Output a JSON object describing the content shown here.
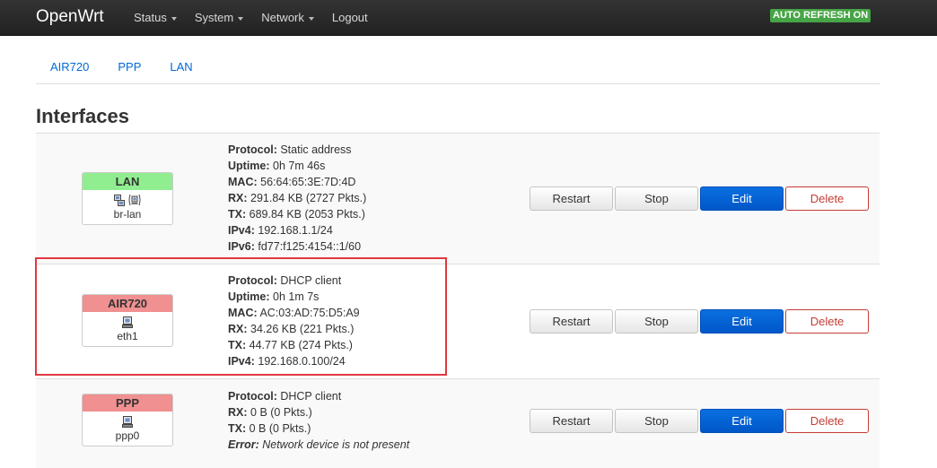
{
  "navbar": {
    "brand": "OpenWrt",
    "menu": [
      "Status",
      "System",
      "Network",
      "Logout"
    ],
    "autorefresh": "AUTO REFRESH ON",
    "autorefresh_color": "#46a546"
  },
  "tabs": [
    "AIR720",
    "PPP",
    "LAN"
  ],
  "page_title": "Interfaces",
  "colors": {
    "lan_header": "#90ee90",
    "wan_header": "#f09090",
    "edit_button": "#0062d9",
    "delete_text": "#c43c35",
    "highlight_border": "#e0383e"
  },
  "interfaces": [
    {
      "name": "LAN",
      "device": "br-lan",
      "icons": [
        "network-bridge-icon",
        "wireless-icon"
      ],
      "details": [
        {
          "label": "Protocol:",
          "value": "Static address"
        },
        {
          "label": "Uptime:",
          "value": "0h 7m 46s"
        },
        {
          "label": "MAC:",
          "value": "56:64:65:3E:7D:4D"
        },
        {
          "label": "RX:",
          "value": "291.84 KB (2727 Pkts.)"
        },
        {
          "label": "TX:",
          "value": "689.84 KB (2053 Pkts.)"
        },
        {
          "label": "IPv4:",
          "value": "192.168.1.1/24"
        },
        {
          "label": "IPv6:",
          "value": "fd77:f125:4154::1/60"
        }
      ]
    },
    {
      "name": "AIR720",
      "device": "eth1",
      "icons": [
        "ethernet-port-icon"
      ],
      "details": [
        {
          "label": "Protocol:",
          "value": "DHCP client"
        },
        {
          "label": "Uptime:",
          "value": "0h 1m 7s"
        },
        {
          "label": "MAC:",
          "value": "AC:03:AD:75:D5:A9"
        },
        {
          "label": "RX:",
          "value": "34.26 KB (221 Pkts.)"
        },
        {
          "label": "TX:",
          "value": "44.77 KB (274 Pkts.)"
        },
        {
          "label": "IPv4:",
          "value": "192.168.0.100/24"
        }
      ]
    },
    {
      "name": "PPP",
      "device": "ppp0",
      "icons": [
        "ethernet-port-icon"
      ],
      "details": [
        {
          "label": "Protocol:",
          "value": "DHCP client"
        },
        {
          "label": "RX:",
          "value": "0 B (0 Pkts.)"
        },
        {
          "label": "TX:",
          "value": "0 B (0 Pkts.)"
        },
        {
          "label": "Error:",
          "value": "Network device is not present"
        }
      ]
    }
  ],
  "buttons": {
    "restart": "Restart",
    "stop": "Stop",
    "edit": "Edit",
    "delete": "Delete"
  }
}
